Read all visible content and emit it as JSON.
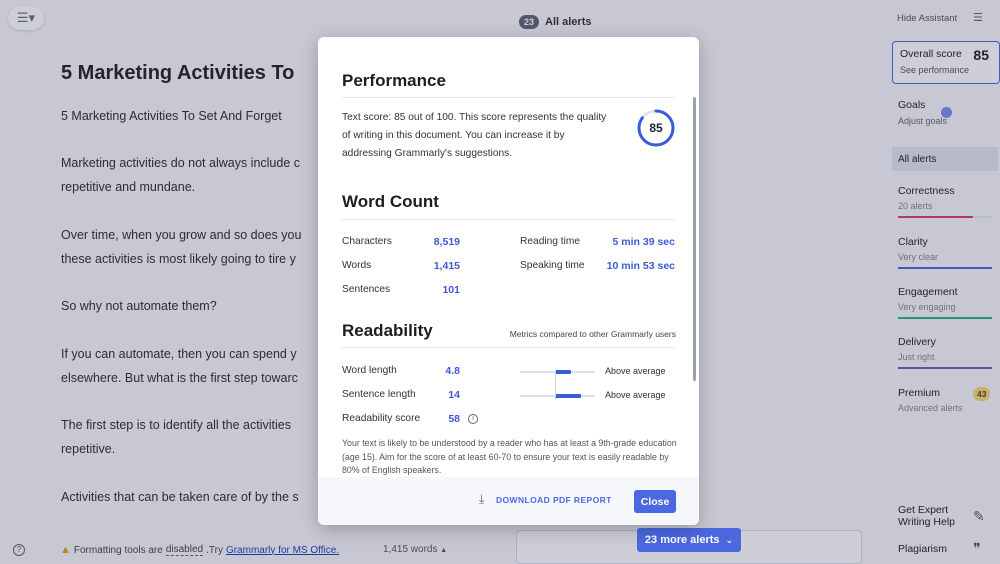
{
  "editor": {
    "menu_icon": "hamburger-menu-icon",
    "alerts_count": "23",
    "alerts_label": "All alerts",
    "doc_title": "5 Marketing Activities To",
    "paragraphs": [
      "5 Marketing Activities To Set And Forget",
      "Marketing activities do not always include c",
      "repetitive and mundane.",
      "Over time, when you grow and so does you",
      "these activities is most likely going to tire y",
      "So why not automate them?",
      "If you can automate, then you can spend y",
      "elsewhere. But what is the first step towarc",
      "The first step is to identify all the activities",
      "repetitive.",
      "Activities that can be taken care of by the s"
    ],
    "footer": {
      "format_prefix": "Formatting tools are",
      "format_disabled": "disabled",
      "format_try": ".Try",
      "format_link": "Grammarly for MS Office.",
      "word_count": "1,415 words"
    },
    "more_alerts": "23 more alerts"
  },
  "sidebar": {
    "hide_assistant": "Hide Assistant",
    "overall_label": "Overall score",
    "overall_score": "85",
    "see_performance": "See performance",
    "goals": "Goals",
    "adjust_goals": "Adjust goals",
    "all_alerts": "All alerts",
    "categories": [
      {
        "name": "Correctness",
        "sub": "20 alerts",
        "color": "#d8475d",
        "fill": 0.8
      },
      {
        "name": "Clarity",
        "sub": "Very clear",
        "color": "#4b68e0",
        "fill": 1.0
      },
      {
        "name": "Engagement",
        "sub": "Very engaging",
        "color": "#2bb08a",
        "fill": 1.0
      },
      {
        "name": "Delivery",
        "sub": "Just right",
        "color": "#8a4fc7",
        "fill": 1.0
      }
    ],
    "premium": "Premium",
    "premium_count": "43",
    "advanced_alerts": "Advanced alerts",
    "expert_line1": "Get Expert",
    "expert_line2": "Writing Help",
    "plagiarism": "Plagiarism"
  },
  "modal": {
    "performance": {
      "heading": "Performance",
      "text": "Text score: 85 out of 100. This score represents the quality of writing in this document. You can increase it by addressing Grammarly's suggestions.",
      "score": "85",
      "score_fraction": 0.85,
      "ring_color": "#3d5ad8"
    },
    "word_count": {
      "heading": "Word Count",
      "characters_label": "Characters",
      "characters": "8,519",
      "words_label": "Words",
      "words": "1,415",
      "sentences_label": "Sentences",
      "sentences": "101",
      "reading_label": "Reading time",
      "reading": "5 min 39 sec",
      "speaking_label": "Speaking time",
      "speaking": "10 min 53 sec"
    },
    "readability": {
      "heading": "Readability",
      "note": "Metrics compared to other Grammarly users",
      "word_length_label": "Word length",
      "word_length": "4.8",
      "word_length_cmp": "Above average",
      "sentence_length_label": "Sentence length",
      "sentence_length": "14",
      "sentence_length_cmp": "Above average",
      "score_label": "Readability score",
      "score": "58",
      "description": "Your text is likely to be understood by a reader who has at least a 9th-grade education (age 15). Aim for the score of at least 60-70 to ensure your text is easily readable by 80% of English speakers."
    },
    "download": "DOWNLOAD PDF REPORT",
    "close": "Close"
  }
}
